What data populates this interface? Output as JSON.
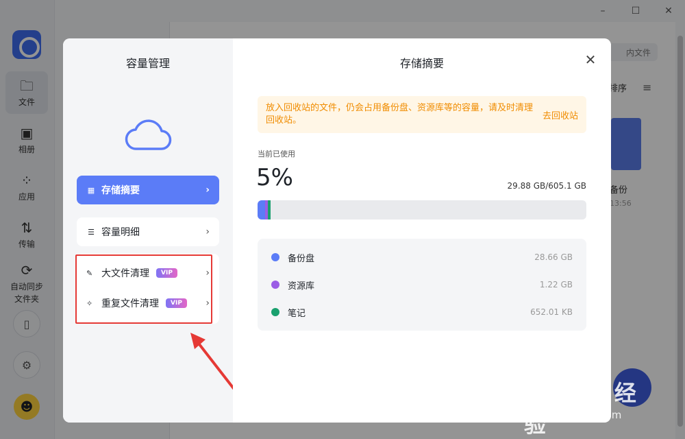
{
  "window": {
    "minimize": "–",
    "maximize": "☐",
    "close": "✕"
  },
  "app_sidebar": {
    "items": [
      {
        "label": "文件",
        "icon": "folder-icon",
        "glyph": "🗀"
      },
      {
        "label": "相册",
        "icon": "photo-icon",
        "glyph": "▣"
      },
      {
        "label": "应用",
        "icon": "apps-icon",
        "glyph": "⁘"
      },
      {
        "label": "传输",
        "icon": "transfer-icon",
        "glyph": "⇅"
      },
      {
        "label": "自动同步文件夹",
        "icon": "sync-icon",
        "glyph": "⟳"
      }
    ],
    "phone_glyph": "▯",
    "settings_glyph": "⚙",
    "avatar_glyph": "☻"
  },
  "background": {
    "search_placeholder": "内文件",
    "sort_label": "排序",
    "list_glyph": "≡",
    "folder_name": "备份",
    "folder_time": "13:56"
  },
  "dialog": {
    "left_title": "容量管理",
    "menu": {
      "summary": {
        "label": "存储摘要",
        "icon_glyph": "▦"
      },
      "detail": {
        "label": "容量明细",
        "icon_glyph": "☰"
      },
      "large_files": {
        "label": "大文件清理",
        "badge": "VIP",
        "icon_glyph": "✎"
      },
      "duplicate_files": {
        "label": "重复文件清理",
        "badge": "VIP",
        "icon_glyph": "✧"
      }
    },
    "chevron": "›",
    "right_title": "存储摘要",
    "close_glyph": "✕",
    "notice": {
      "text": "放入回收站的文件，仍会占用备份盘、资源库等的容量，请及时清理回收站。",
      "link": "去回收站"
    },
    "usage": {
      "label": "当前已使用",
      "percent": "5%",
      "size": "29.88 GB/605.1 GB",
      "segments": [
        {
          "name": "备份盘",
          "fraction": 0.0474,
          "color": "#5b7cf7"
        },
        {
          "name": "资源库",
          "fraction": 0.002,
          "color": "#9b5de5"
        },
        {
          "name": "笔记",
          "fraction": 0.0011,
          "color": "#19a06e"
        }
      ]
    },
    "legend": [
      {
        "name": "备份盘",
        "value": "28.66 GB",
        "color": "#5b7cf7"
      },
      {
        "name": "资源库",
        "value": "1.22 GB",
        "color": "#9b5de5"
      },
      {
        "name": "笔记",
        "value": "652.01 KB",
        "color": "#19a06e"
      }
    ]
  },
  "watermark": {
    "main": "Bai du 经验",
    "sub": "jingyan.baidu.com"
  },
  "colors": {
    "accent": "#5b7cf7",
    "notice": "#f08c00",
    "annotation": "#e53935"
  }
}
